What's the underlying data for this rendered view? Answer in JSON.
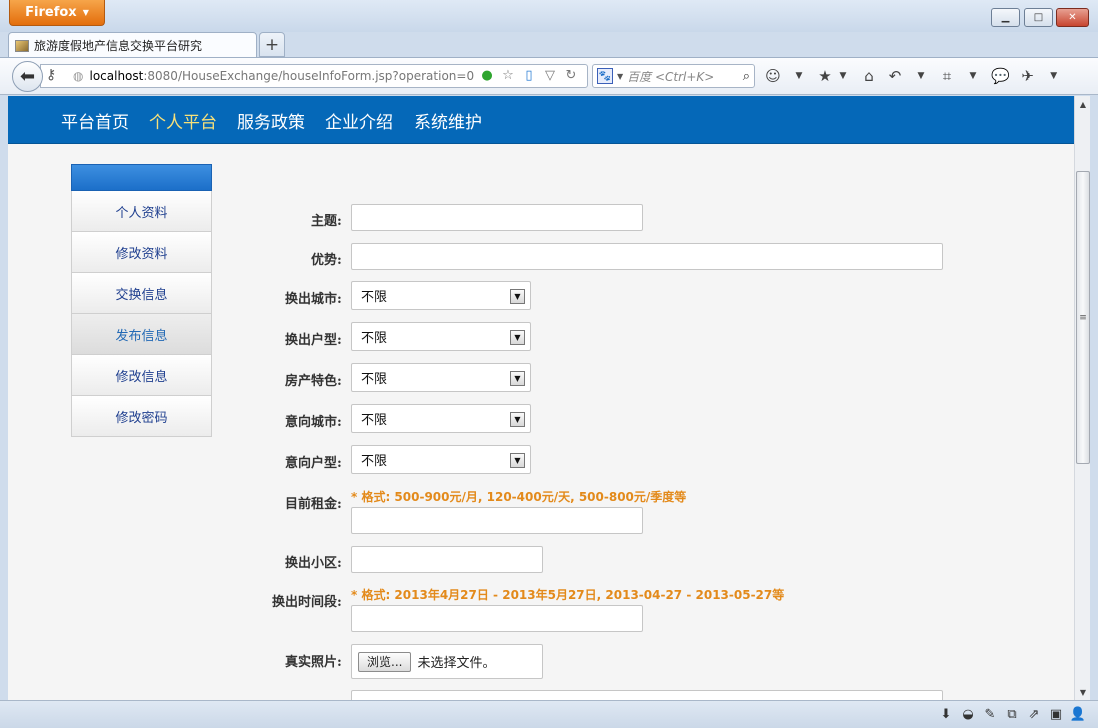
{
  "browser": {
    "menu_button": "Firefox",
    "tab_title": "旅游度假地产信息交换平台研究",
    "new_tab": "+",
    "url_host": "localhost",
    "url_rest": ":8080/HouseExchange/houseInfoForm.jsp?operation=0",
    "search_placeholder": "百度 <Ctrl+K>",
    "search_engine_icon": "baidu-paw-icon"
  },
  "site_nav": {
    "items": [
      "平台首页",
      "个人平台",
      "服务政策",
      "企业介绍",
      "系统维护"
    ],
    "active_index": 1
  },
  "side_menu": {
    "items": [
      "个人资料",
      "修改资料",
      "交换信息",
      "发布信息",
      "修改信息",
      "修改密码"
    ],
    "active_index": 3
  },
  "form": {
    "subject_label": "主题:",
    "advantage_label": "优势:",
    "out_city_label": "换出城市:",
    "out_city_value": "不限",
    "out_type_label": "换出户型:",
    "out_type_value": "不限",
    "feature_label": "房产特色:",
    "feature_value": "不限",
    "target_city_label": "意向城市:",
    "target_city_value": "不限",
    "target_type_label": "意向户型:",
    "target_type_value": "不限",
    "rent_label": "目前租金:",
    "rent_hint": "* 格式: 500-900元/月, 120-400元/天, 500-800元/季度等",
    "community_label": "换出小区:",
    "period_label": "换出时间段:",
    "period_hint": "* 格式:  2013年4月27日 - 2013年5月27日, 2013-04-27 - 2013-05-27等",
    "photo_label": "真实照片:",
    "browse_button": "浏览...",
    "no_file": "未选择文件。"
  },
  "colors": {
    "nav_bg": "#0568b8",
    "nav_active": "#f6e07a",
    "hint": "#e38a1b"
  }
}
